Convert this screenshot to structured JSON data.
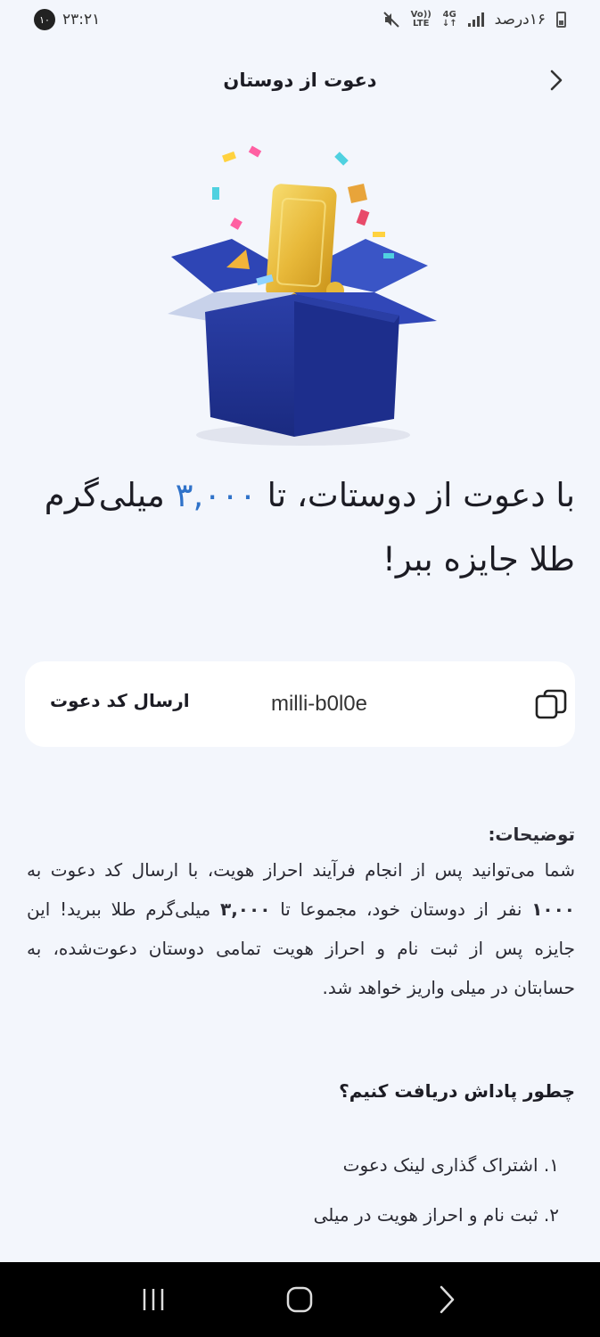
{
  "status_bar": {
    "time": "۲۳:۲۱",
    "notification_count": "۱۰",
    "battery_text": "۱۶درصد",
    "network_type": "4G",
    "volte_label_1": "Vo))",
    "volte_label_2": "LTE"
  },
  "header": {
    "title": "دعوت از دوستان"
  },
  "headline": {
    "part1": "با دعوت از دوستات، تا ",
    "amount": "۳,۰۰۰",
    "part2": " میلی‌گرم طلا جایزه ببر!"
  },
  "invite": {
    "code": "milli-b0l0e",
    "send_label": "ارسال کد دعوت"
  },
  "description": {
    "title": "توضیحات:",
    "text_1": "شما می‌توانید پس از انجام فرآیند احراز هویت، با ارسال کد دعوت به ",
    "count": "۱۰۰۰",
    "text_2": " نفر از دوستان خود، مجموعا تا ",
    "amount": "۳,۰۰۰",
    "text_3": " میلی‌گرم طلا ببرید! این جایزه پس از ثبت نام و احراز هویت تمامی دوستان دعوت‌شده، به حسابتان در میلی واریز خواهد شد."
  },
  "how": {
    "title": "چطور پاداش دریافت کنیم؟",
    "steps": [
      "۱. اشتراک گذاری لینک دعوت",
      "۲. ثبت نام و احراز هویت در میلی"
    ]
  },
  "colors": {
    "accent": "#2f72c9",
    "box_blue": "#23369a",
    "gold": "#e8b93a",
    "background": "#f3f6fc"
  }
}
